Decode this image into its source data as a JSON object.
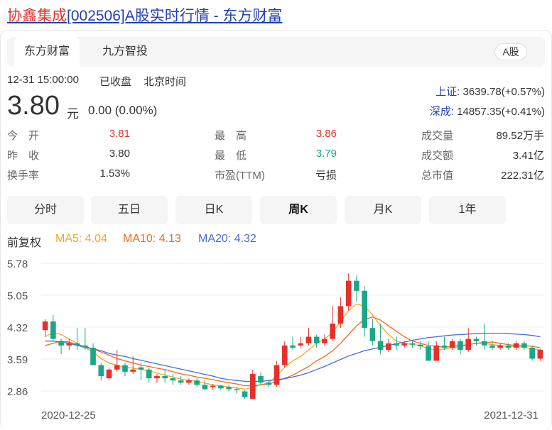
{
  "title": {
    "name": "协鑫集成",
    "rest": "[002506]A股实时行情 - 东方财富"
  },
  "tabs": [
    {
      "label": "东方财富",
      "active": true
    },
    {
      "label": "九方智投",
      "active": false
    }
  ],
  "market_badge": "A股",
  "quote": {
    "datetime": "12-31 15:00:00",
    "status": "已收盘",
    "timezone": "北京时间",
    "price": "3.80",
    "unit": "元",
    "change": "0.00 (0.00%)"
  },
  "indices": [
    {
      "label": "上证:",
      "value": "3639.78(+0.57%)"
    },
    {
      "label": "深成:",
      "value": "14857.35(+0.41%)"
    }
  ],
  "stats": {
    "open_label": "今　开",
    "open": "3.81",
    "prev_label": "昨　收",
    "prev": "3.80",
    "turnover_label": "换手率",
    "turnover": "1.53%",
    "high_label": "最　高",
    "high": "3.86",
    "low_label": "最　低",
    "low": "3.79",
    "pe_label": "市盈(TTM)",
    "pe": "亏损",
    "volume_label": "成交量",
    "volume": "89.52万手",
    "amount_label": "成交额",
    "amount": "3.41亿",
    "mcap_label": "总市值",
    "mcap": "222.31亿"
  },
  "periods": [
    {
      "label": "分时",
      "active": false
    },
    {
      "label": "五日",
      "active": false
    },
    {
      "label": "日K",
      "active": false
    },
    {
      "label": "周K",
      "active": true
    },
    {
      "label": "月K",
      "active": false
    },
    {
      "label": "1年",
      "active": false
    }
  ],
  "adjust_label": "前复权",
  "ma": [
    {
      "label": "MA5: 4.04",
      "color": "#f5a623"
    },
    {
      "label": "MA10: 4.13",
      "color": "#f06a1e"
    },
    {
      "label": "MA20: 4.32",
      "color": "#4a6cd8"
    }
  ],
  "chart_data": {
    "type": "candlestick",
    "y_ticks": [
      "5.78",
      "5.05",
      "4.32",
      "3.59",
      "2.86"
    ],
    "ylim": [
      2.86,
      5.78
    ],
    "x_labels": [
      "2020-12-25",
      "2021-12-31"
    ],
    "up_color": "#e3322b",
    "down_color": "#1aa687",
    "candles": [
      [
        4.25,
        4.45,
        4.1,
        4.5
      ],
      [
        4.45,
        4.05,
        4.0,
        4.6
      ],
      [
        4.0,
        3.9,
        3.7,
        4.05
      ],
      [
        3.9,
        3.95,
        3.8,
        4.05
      ],
      [
        3.95,
        3.9,
        3.8,
        4.3
      ],
      [
        3.9,
        3.85,
        3.8,
        4.3
      ],
      [
        3.85,
        3.45,
        3.45,
        3.95
      ],
      [
        3.45,
        3.2,
        3.1,
        3.5
      ],
      [
        3.15,
        3.35,
        3.1,
        3.4
      ],
      [
        3.35,
        3.45,
        3.3,
        3.8
      ],
      [
        3.45,
        3.3,
        3.2,
        3.5
      ],
      [
        3.3,
        3.35,
        3.25,
        3.65
      ],
      [
        3.4,
        3.35,
        3.1,
        3.5
      ],
      [
        3.35,
        3.15,
        3.05,
        3.4
      ],
      [
        3.15,
        3.2,
        3.05,
        3.25
      ],
      [
        3.2,
        3.15,
        3.05,
        3.35
      ],
      [
        3.15,
        3.1,
        3.0,
        3.25
      ],
      [
        3.1,
        3.05,
        3.0,
        3.2
      ],
      [
        3.05,
        3.1,
        3.0,
        3.15
      ],
      [
        3.1,
        3.0,
        2.95,
        3.15
      ],
      [
        3.0,
        2.9,
        2.88,
        3.1
      ],
      [
        2.95,
        2.98,
        2.88,
        3.02
      ],
      [
        2.98,
        2.92,
        2.88,
        3.0
      ],
      [
        2.95,
        2.9,
        2.85,
        3.0
      ],
      [
        2.9,
        2.88,
        2.8,
        2.95
      ],
      [
        2.85,
        2.72,
        2.68,
        2.88
      ],
      [
        2.68,
        3.25,
        2.68,
        3.35
      ],
      [
        3.2,
        3.05,
        3.0,
        3.28
      ],
      [
        3.05,
        3.0,
        2.95,
        3.1
      ],
      [
        3.0,
        3.45,
        2.95,
        3.55
      ],
      [
        3.45,
        3.9,
        3.4,
        4.0
      ],
      [
        3.9,
        3.85,
        3.8,
        4.1
      ],
      [
        3.9,
        3.95,
        3.85,
        4.1
      ],
      [
        3.95,
        4.1,
        3.9,
        4.3
      ],
      [
        4.1,
        3.95,
        3.85,
        4.15
      ],
      [
        3.95,
        4.05,
        3.9,
        4.15
      ],
      [
        4.05,
        4.4,
        4.0,
        4.8
      ],
      [
        4.4,
        4.8,
        4.3,
        5.0
      ],
      [
        4.8,
        5.38,
        4.7,
        5.55
      ],
      [
        5.38,
        5.15,
        4.9,
        5.5
      ],
      [
        5.15,
        4.3,
        4.1,
        5.25
      ],
      [
        4.3,
        4.0,
        3.9,
        4.5
      ],
      [
        4.0,
        3.8,
        3.7,
        4.4
      ],
      [
        3.8,
        3.95,
        3.75,
        4.05
      ],
      [
        3.95,
        3.9,
        3.8,
        4.1
      ],
      [
        3.9,
        3.95,
        3.85,
        4.0
      ],
      [
        3.95,
        3.92,
        3.85,
        4.0
      ],
      [
        3.92,
        3.88,
        3.8,
        4.0
      ],
      [
        3.88,
        3.55,
        3.55,
        4.0
      ],
      [
        3.55,
        3.9,
        3.55,
        4.0
      ],
      [
        3.9,
        3.85,
        3.8,
        4.1
      ],
      [
        3.85,
        4.0,
        3.8,
        4.05
      ],
      [
        4.0,
        3.8,
        3.7,
        4.05
      ],
      [
        3.8,
        4.05,
        3.75,
        4.3
      ],
      [
        4.05,
        4.0,
        3.9,
        4.1
      ],
      [
        4.0,
        3.9,
        3.8,
        4.4
      ],
      [
        3.9,
        3.85,
        3.8,
        4.0
      ],
      [
        3.85,
        3.9,
        3.8,
        3.95
      ],
      [
        3.9,
        3.85,
        3.8,
        3.95
      ],
      [
        3.85,
        3.95,
        3.8,
        4.0
      ],
      [
        3.95,
        3.85,
        3.8,
        4.0
      ],
      [
        3.85,
        3.6,
        3.55,
        3.9
      ],
      [
        3.6,
        3.8,
        3.55,
        3.82
      ]
    ],
    "ma5": [
      4.1,
      4.2,
      4.15,
      4.05,
      3.95,
      3.85,
      3.75,
      3.6,
      3.5,
      3.45,
      3.4,
      3.38,
      3.35,
      3.32,
      3.27,
      3.22,
      3.18,
      3.13,
      3.1,
      3.08,
      3.04,
      3.0,
      2.98,
      2.95,
      2.93,
      2.9,
      2.95,
      3.0,
      3.05,
      3.2,
      3.4,
      3.55,
      3.65,
      3.8,
      3.95,
      4.05,
      4.2,
      4.45,
      4.7,
      4.85,
      4.8,
      4.6,
      4.35,
      4.15,
      4.0,
      3.95,
      3.92,
      3.9,
      3.82,
      3.8,
      3.82,
      3.85,
      3.87,
      3.92,
      3.95,
      3.95,
      3.92,
      3.9,
      3.88,
      3.88,
      3.86,
      3.82,
      3.8
    ],
    "ma10": [
      3.9,
      3.95,
      4.0,
      3.98,
      3.92,
      3.88,
      3.82,
      3.75,
      3.68,
      3.6,
      3.55,
      3.5,
      3.45,
      3.42,
      3.38,
      3.35,
      3.3,
      3.25,
      3.22,
      3.18,
      3.15,
      3.12,
      3.08,
      3.05,
      3.02,
      2.98,
      2.98,
      3.0,
      3.02,
      3.08,
      3.15,
      3.22,
      3.32,
      3.42,
      3.55,
      3.65,
      3.78,
      3.95,
      4.15,
      4.35,
      4.5,
      4.55,
      4.48,
      4.35,
      4.22,
      4.1,
      4.0,
      3.95,
      3.9,
      3.88,
      3.86,
      3.88,
      3.9,
      3.92,
      3.95,
      3.97,
      3.98,
      3.95,
      3.92,
      3.9,
      3.9,
      3.88,
      3.85
    ],
    "ma20": [
      4.0,
      4.0,
      3.98,
      3.95,
      3.9,
      3.86,
      3.82,
      3.78,
      3.72,
      3.68,
      3.65,
      3.6,
      3.56,
      3.52,
      3.48,
      3.44,
      3.4,
      3.36,
      3.32,
      3.28,
      3.24,
      3.2,
      3.15,
      3.12,
      3.1,
      3.08,
      3.08,
      3.08,
      3.1,
      3.12,
      3.14,
      3.18,
      3.22,
      3.28,
      3.35,
      3.42,
      3.5,
      3.58,
      3.66,
      3.72,
      3.78,
      3.82,
      3.86,
      3.9,
      3.94,
      3.98,
      4.02,
      4.05,
      4.08,
      4.1,
      4.12,
      4.14,
      4.15,
      4.16,
      4.17,
      4.18,
      4.18,
      4.18,
      4.17,
      4.16,
      4.15,
      4.13,
      4.1
    ]
  }
}
